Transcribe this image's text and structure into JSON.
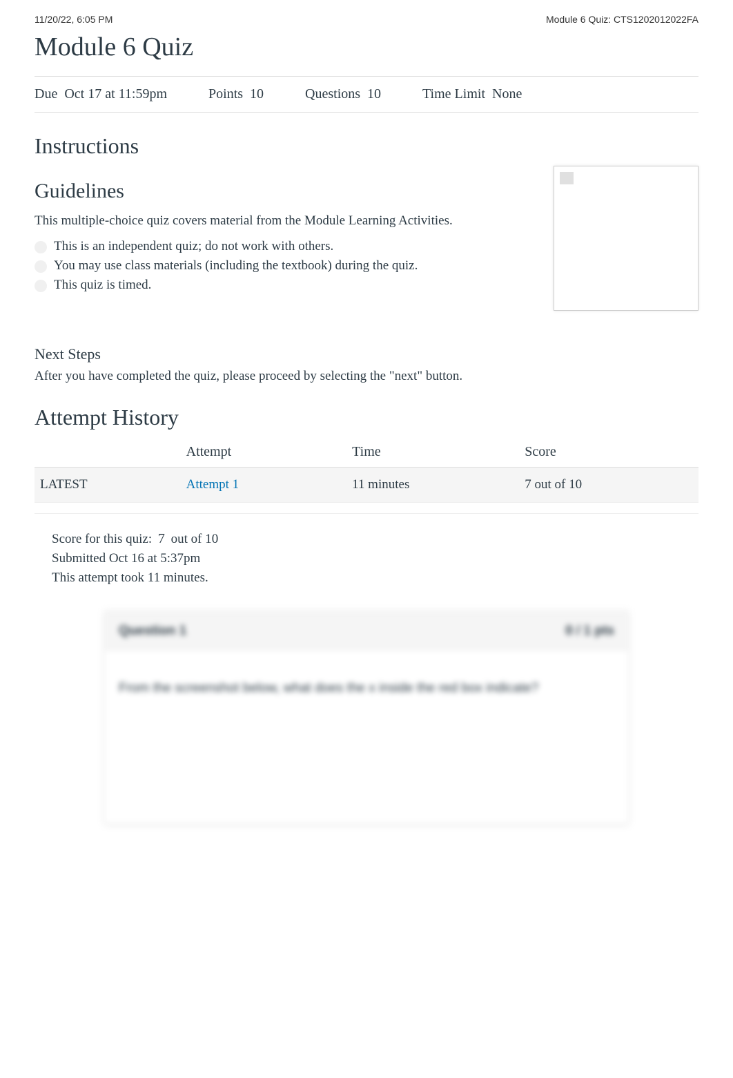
{
  "print_header": {
    "timestamp": "11/20/22, 6:05 PM",
    "doc_title": "Module 6 Quiz: CTS1202012022FA"
  },
  "page_title": "Module 6 Quiz",
  "meta": {
    "due_label": "Due",
    "due_value": "Oct 17 at 11:59pm",
    "points_label": "Points",
    "points_value": "10",
    "questions_label": "Questions",
    "questions_value": "10",
    "time_limit_label": "Time Limit",
    "time_limit_value": "None"
  },
  "instructions_heading": "Instructions",
  "guidelines_heading": "Guidelines",
  "intro_para": "This multiple-choice quiz covers material from the Module Learning Activities.",
  "bullets": [
    "This is an independent quiz; do not work with others.",
    "You may use class materials (including the textbook) during the quiz.",
    "This quiz is timed."
  ],
  "next_steps_heading": "Next Steps",
  "next_steps_para": "After you have completed the quiz, please proceed by selecting the \"next\" button.",
  "attempt_history_heading": "Attempt History",
  "history_table": {
    "headers": [
      "",
      "Attempt",
      "Time",
      "Score"
    ],
    "rows": [
      {
        "badge": "LATEST",
        "attempt_label": "Attempt 1",
        "time": "11 minutes",
        "score": "7 out of 10"
      }
    ]
  },
  "score_summary": {
    "score_prefix": "Score for this quiz:",
    "score_value": "7",
    "score_suffix": "out of 10",
    "submitted": "Submitted Oct 16 at 5:37pm",
    "duration": "This attempt took 11 minutes."
  },
  "question": {
    "label": "Question 1",
    "points": "0 / 1 pts",
    "body": "From the screenshot below, what does the x inside the red box indicate?"
  }
}
